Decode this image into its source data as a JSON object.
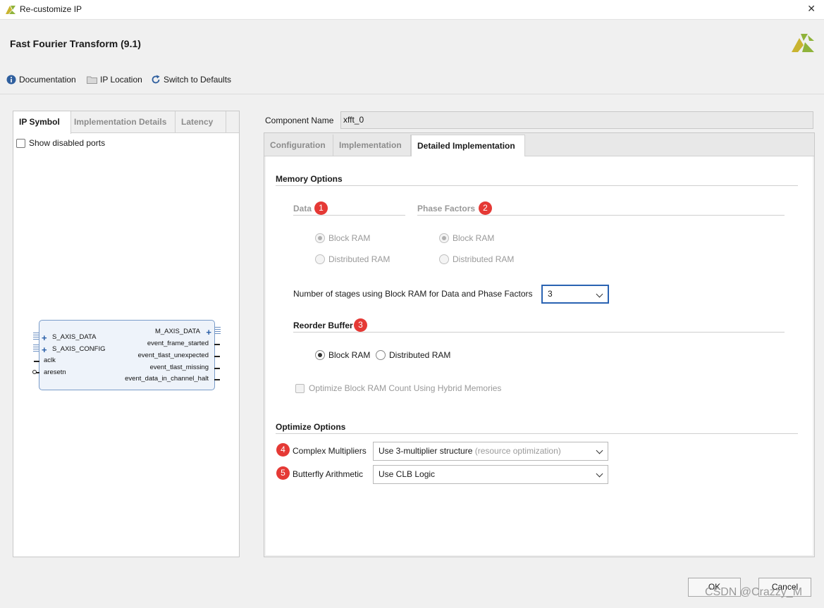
{
  "window": {
    "title": "Re-customize IP",
    "close_glyph": "✕"
  },
  "header": {
    "page_title": "Fast Fourier Transform (9.1)",
    "toolbar": [
      {
        "label": "Documentation",
        "icon": "info-icon"
      },
      {
        "label": "IP Location",
        "icon": "folder-icon"
      },
      {
        "label": "Switch to Defaults",
        "icon": "refresh-icon"
      }
    ]
  },
  "left_panel": {
    "tabs": [
      "IP Symbol",
      "Implementation Details",
      "Latency"
    ],
    "active_tab": "IP Symbol",
    "show_disabled_ports": {
      "label": "Show disabled ports",
      "checked": false
    },
    "symbol": {
      "left_ports": [
        "S_AXIS_DATA",
        "S_AXIS_CONFIG",
        "aclk",
        "aresetn"
      ],
      "right_ports": [
        "M_AXIS_DATA",
        "event_frame_started",
        "event_tlast_unexpected",
        "event_tlast_missing",
        "event_data_in_channel_halt"
      ]
    }
  },
  "component_name": {
    "label": "Component Name",
    "value": "xfft_0"
  },
  "right_panel": {
    "tabs": [
      "Configuration",
      "Implementation",
      "Detailed Implementation"
    ],
    "active_tab": "Detailed Implementation",
    "memory_options": {
      "heading": "Memory Options",
      "data": {
        "label": "Data",
        "badge": "1",
        "options": [
          "Block RAM",
          "Distributed RAM"
        ],
        "selected": "Block RAM",
        "enabled": false
      },
      "phase_factors": {
        "label": "Phase Factors",
        "badge": "2",
        "options": [
          "Block RAM",
          "Distributed RAM"
        ],
        "selected": "Block RAM",
        "enabled": false
      },
      "stages": {
        "label": "Number of stages using Block RAM for Data and Phase Factors",
        "value": "3"
      },
      "reorder_buffer": {
        "label": "Reorder Buffer",
        "badge": "3",
        "options": [
          "Block RAM",
          "Distributed RAM"
        ],
        "selected": "Block RAM"
      },
      "hybrid": {
        "label": "Optimize Block RAM Count Using Hybrid Memories",
        "checked": false,
        "enabled": false
      }
    },
    "optimize_options": {
      "heading": "Optimize Options",
      "complex_multipliers": {
        "label": "Complex Multipliers",
        "badge": "4",
        "value": "Use 3-multiplier structure",
        "value_hint": "(resource optimization)"
      },
      "butterfly_arithmetic": {
        "label": "Butterfly Arithmetic",
        "badge": "5",
        "value": "Use CLB Logic"
      }
    }
  },
  "footer": {
    "ok_label": "OK",
    "cancel_label": "Cancel",
    "watermark": "CSDN @Crazzy_M"
  },
  "colors": {
    "accent": "#2a63b2",
    "badge": "#e53935",
    "logo_yellow": "#c9b430",
    "logo_green": "#8fb33a"
  }
}
